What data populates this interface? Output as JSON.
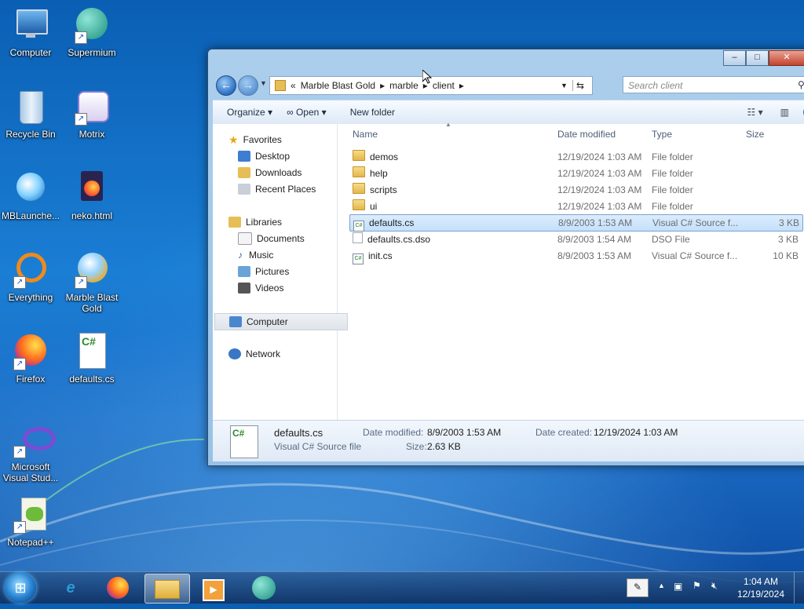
{
  "desktop": {
    "icons": [
      {
        "label": "Computer"
      },
      {
        "label": "Supermium"
      },
      {
        "label": "Recycle Bin"
      },
      {
        "label": "Motrix"
      },
      {
        "label": "MBLaunche..."
      },
      {
        "label": "neko.html"
      },
      {
        "label": "Everything"
      },
      {
        "label": "Marble Blast Gold"
      },
      {
        "label": "Firefox"
      },
      {
        "label": "defaults.cs"
      },
      {
        "label": "Microsoft Visual Stud..."
      },
      {
        "label": "Notepad++"
      }
    ]
  },
  "explorer": {
    "address": {
      "overflow": "«",
      "path": [
        "Marble Blast Gold",
        "marble",
        "client"
      ]
    },
    "search_placeholder": "Search client",
    "toolbar": {
      "organize": "Organize",
      "open": "Open",
      "new_folder": "New folder"
    },
    "nav": {
      "favorites": "Favorites",
      "fav_items": [
        "Desktop",
        "Downloads",
        "Recent Places"
      ],
      "libraries": "Libraries",
      "lib_items": [
        "Documents",
        "Music",
        "Pictures",
        "Videos"
      ],
      "computer": "Computer",
      "network": "Network"
    },
    "columns": {
      "name": "Name",
      "date": "Date modified",
      "type": "Type",
      "size": "Size"
    },
    "files": [
      {
        "name": "demos",
        "date": "12/19/2024 1:03 AM",
        "type": "File folder",
        "size": ""
      },
      {
        "name": "help",
        "date": "12/19/2024 1:03 AM",
        "type": "File folder",
        "size": ""
      },
      {
        "name": "scripts",
        "date": "12/19/2024 1:03 AM",
        "type": "File folder",
        "size": ""
      },
      {
        "name": "ui",
        "date": "12/19/2024 1:03 AM",
        "type": "File folder",
        "size": ""
      },
      {
        "name": "defaults.cs",
        "date": "8/9/2003 1:53 AM",
        "type": "Visual C# Source f...",
        "size": "3 KB"
      },
      {
        "name": "defaults.cs.dso",
        "date": "8/9/2003 1:54 AM",
        "type": "DSO File",
        "size": "3 KB"
      },
      {
        "name": "init.cs",
        "date": "8/9/2003 1:53 AM",
        "type": "Visual C# Source f...",
        "size": "10 KB"
      }
    ],
    "details": {
      "name": "defaults.cs",
      "type": "Visual C# Source file",
      "modified_label": "Date modified:",
      "modified": "8/9/2003 1:53 AM",
      "created_label": "Date created:",
      "created": "12/19/2024 1:03 AM",
      "size_label": "Size:",
      "size": "2.63 KB"
    }
  },
  "taskbar": {
    "time": "1:04 AM",
    "date": "12/19/2024"
  }
}
